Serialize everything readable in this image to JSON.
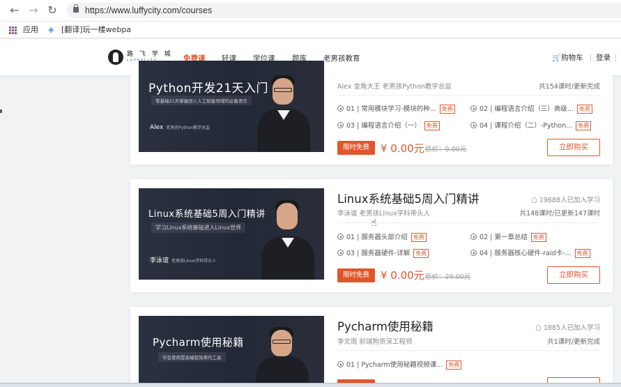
{
  "browser": {
    "url": "https://www.luffycity.com/courses",
    "bookmarks": {
      "apps": "应用",
      "item1": "[翻译]玩一楼webpa"
    }
  },
  "site": {
    "logo_text": "路 飞 学 城",
    "logo_sub": "LUFFYCITY",
    "menu": [
      "免费课",
      "轻课",
      "学位课",
      "题库",
      "老男孩教育"
    ],
    "cart": "购物车",
    "login": "登录"
  },
  "courses": [
    {
      "banner_title": "Python开发21天入门",
      "banner_sub": "零基础21天掌握进入人工智能领域的必备语言",
      "banner_author": "Alex",
      "banner_author_role": "老男孩Python教学总监",
      "title": "Python开发21天入门",
      "teacher": "Alex 金角大王 老男孩Python教学总监",
      "learners": "",
      "stats": "共154课时/更新完成",
      "lessons": [
        {
          "text": "01 | 常用模块学习-模块的种...",
          "tag": "免费"
        },
        {
          "text": "02 | 编程语言介绍（三）高级...",
          "tag": "免费"
        },
        {
          "text": "03 | 编程语言介绍（一）",
          "tag": "免费"
        },
        {
          "text": "04 | 课程介绍（二）-Python...",
          "tag": "免费"
        }
      ],
      "limited": "限时免费",
      "price": "¥ 0.00元",
      "orig_price": "原价：9.00元",
      "buy": "立即购买"
    },
    {
      "banner_title": "Linux系统基础5周入门精讲",
      "banner_sub": "学习Linux系统基础进入Linux世界",
      "banner_author": "李泳谊",
      "banner_author_role": "老男孩Linux学科带头人",
      "title": "Linux系统基础5周入门精讲",
      "teacher": "李泳谊 老男孩Linux学科带头人",
      "learners": "19688人已加入学习",
      "stats": "共148课时/已更新147课时",
      "lessons": [
        {
          "text": "01 | 服务器头部介绍",
          "tag": "免费"
        },
        {
          "text": "02 | 第一章总结",
          "tag": "免费"
        },
        {
          "text": "03 | 服务器硬件-详解",
          "tag": "免费"
        },
        {
          "text": "04 | 服务器核心硬件-raid卡-...",
          "tag": "免费"
        }
      ],
      "limited": "限时免费",
      "price": "¥ 0.00元",
      "orig_price": "原价：29.00元",
      "buy": "立即购买"
    },
    {
      "banner_title": "Pycharm使用秘籍",
      "banner_sub": "学会使用提高编程效率的工具",
      "title": "Pycharm使用秘籍",
      "teacher": "李文周 前瑞狗资深工程师",
      "learners": "1885人已加入学习",
      "stats": "共1课时/更新完成",
      "lessons": [
        {
          "text": "01 | Pycharm使用秘籍视频课...",
          "tag": "免费"
        }
      ]
    }
  ],
  "colors": {
    "accent": "#e0562b",
    "banner": "#2b3140"
  }
}
